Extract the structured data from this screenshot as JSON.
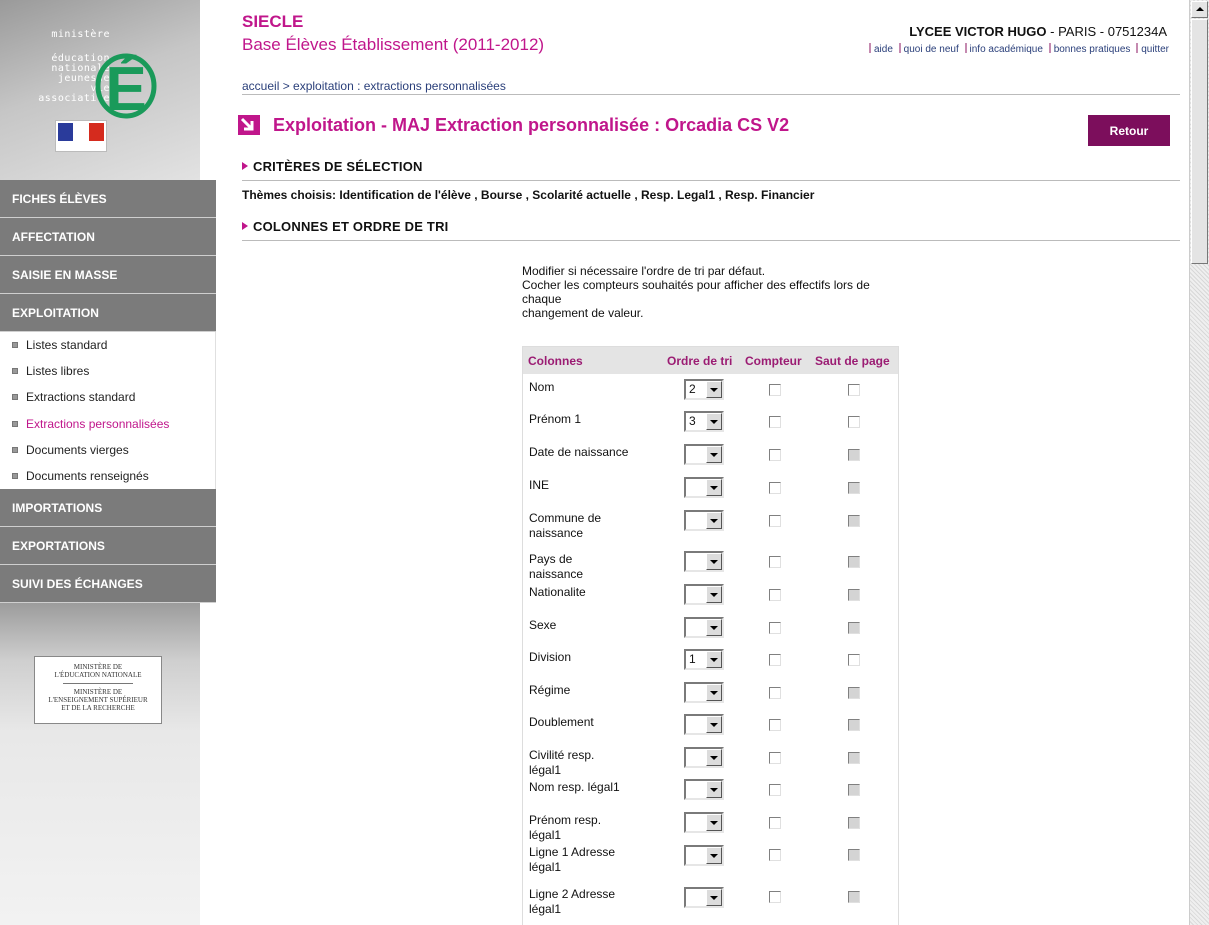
{
  "sidebar": {
    "logo_words": [
      "ministère",
      "éducation",
      "nationale",
      "jeunesse",
      "vie associative"
    ],
    "logo_letter": "É",
    "sections_top": [
      "FICHES ÉLÈVES",
      "AFFECTATION",
      "SAISIE EN MASSE",
      "EXPLOITATION"
    ],
    "submenu": [
      {
        "label": "Listes standard",
        "active": false
      },
      {
        "label": "Listes libres",
        "active": false
      },
      {
        "label": "Extractions standard",
        "active": false
      },
      {
        "label": "Extractions personnalisées",
        "active": true
      },
      {
        "label": "Documents vierges",
        "active": false
      },
      {
        "label": "Documents renseignés",
        "active": false
      }
    ],
    "sections_bottom": [
      "IMPORTATIONS",
      "EXPORTATIONS",
      "SUIVI DES ÉCHANGES"
    ],
    "ministry_box": {
      "line1": "MINISTÈRE DE",
      "line2": "L'ÉDUCATION NATIONALE",
      "line3": "MINISTÈRE DE",
      "line4": "L'ENSEIGNEMENT SUPÉRIEUR",
      "line5": "ET DE LA RECHERCHE"
    }
  },
  "header": {
    "app_name": "SIECLE",
    "app_subtitle": "Base Élèves Établissement (2011-2012)",
    "school_name": "LYCEE VICTOR HUGO",
    "school_city": "PARIS",
    "school_code": "0751234A",
    "links": [
      "aide",
      "quoi de neuf",
      "info académique",
      "bonnes pratiques",
      "quitter"
    ],
    "breadcrumb": "accueil  > exploitation : extractions personnalisées"
  },
  "main": {
    "page_title": "Exploitation - MAJ Extraction personnalisée : Orcadia CS V2",
    "retour_label": "Retour",
    "section_criteria": "CRITÈRES DE SÉLECTION",
    "themes_text": "Thèmes choisis: Identification de l'élève , Bourse , Scolarité actuelle , Resp. Legal1 , Resp. Financier",
    "section_columns": "COLONNES ET ORDRE DE TRI",
    "instructions": {
      "line1": "Modifier si nécessaire l'ordre de tri par défaut.",
      "line2": "Cocher les compteurs souhaités pour afficher des effectifs lors de chaque",
      "line3": "changement de valeur."
    },
    "table": {
      "headers": {
        "col": "Colonnes",
        "order": "Ordre de tri",
        "counter": "Compteur",
        "pagebreak": "Saut de page"
      },
      "rows": [
        {
          "label": "Nom",
          "order": "2",
          "pagebreak_enabled": true
        },
        {
          "label": "Prénom 1",
          "order": "3",
          "pagebreak_enabled": true
        },
        {
          "label": "Date de naissance",
          "order": "",
          "pagebreak_enabled": false
        },
        {
          "label": "INE",
          "order": "",
          "pagebreak_enabled": false
        },
        {
          "label": "Commune de naissance",
          "order": "",
          "pagebreak_enabled": false
        },
        {
          "label": "Pays de naissance",
          "order": "",
          "pagebreak_enabled": false
        },
        {
          "label": "Nationalite",
          "order": "",
          "pagebreak_enabled": false
        },
        {
          "label": "Sexe",
          "order": "",
          "pagebreak_enabled": false
        },
        {
          "label": "Division",
          "order": "1",
          "pagebreak_enabled": true
        },
        {
          "label": "Régime",
          "order": "",
          "pagebreak_enabled": false
        },
        {
          "label": "Doublement",
          "order": "",
          "pagebreak_enabled": false
        },
        {
          "label": "Civilité resp. légal1",
          "order": "",
          "pagebreak_enabled": false
        },
        {
          "label": "Nom resp. légal1",
          "order": "",
          "pagebreak_enabled": false
        },
        {
          "label": "Prénom resp. légal1",
          "order": "",
          "pagebreak_enabled": false
        },
        {
          "label": "Ligne 1 Adresse légal1",
          "order": "",
          "pagebreak_enabled": false
        },
        {
          "label": "Ligne 2 Adresse légal1",
          "order": "",
          "pagebreak_enabled": false
        }
      ]
    }
  },
  "colors": {
    "accent": "#c0168b",
    "button": "#7c0e5c",
    "menu_section": "#7b7b7b",
    "link": "#2a3f7a"
  }
}
